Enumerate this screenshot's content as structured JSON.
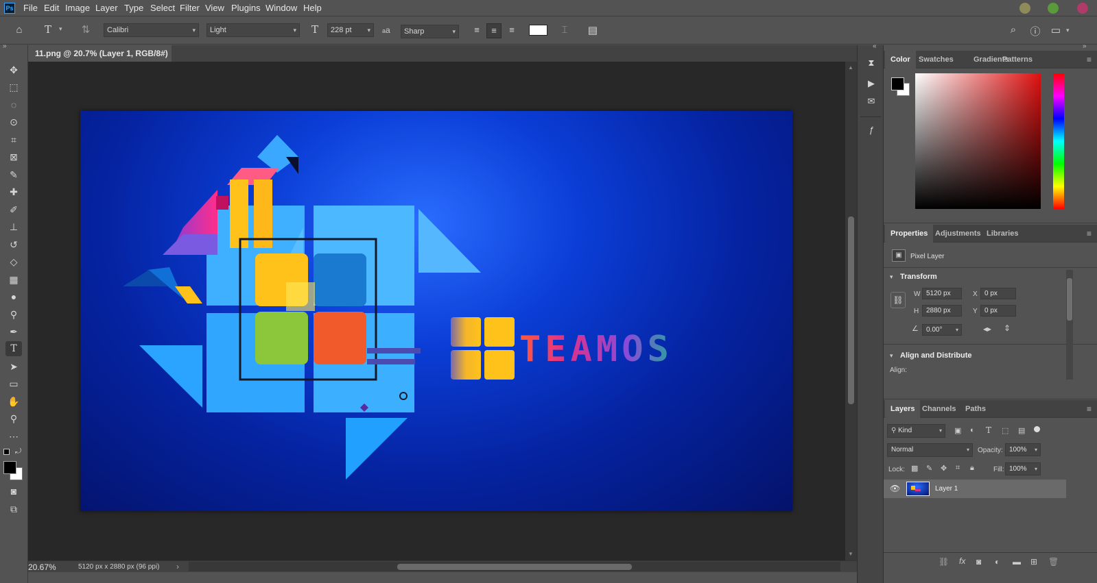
{
  "app": {
    "logo": "Ps"
  },
  "menu": [
    "File",
    "Edit",
    "Image",
    "Layer",
    "Type",
    "Select",
    "Filter",
    "View",
    "Plugins",
    "Window",
    "Help"
  ],
  "window_buttons": {
    "minimize_color": "#8e8a5a",
    "maximize_color": "#5a9a3a",
    "close_color": "#b03a6a"
  },
  "options": {
    "font_family": "Calibri",
    "font_style": "Light",
    "font_size": "228 pt",
    "aa_label": "a",
    "antialias": "Sharp",
    "text_color": "#ffffff"
  },
  "document": {
    "tab_title": "11.png @ 20.7% (Layer 1, RGB/8#)",
    "close_glyph": "×",
    "zoom": "20.67%",
    "doc_info": "5120 px x 2880 px (96 ppi)",
    "status_arrow": "›",
    "artwork_wordmark": "TEAMOS"
  },
  "color_panel": {
    "tabs": [
      "Color",
      "Swatches",
      "Gradients",
      "Patterns"
    ],
    "foreground": "#000000",
    "background": "#ffffff",
    "hue_color": "#e01010"
  },
  "properties_panel": {
    "tabs": [
      "Properties",
      "Adjustments",
      "Libraries"
    ],
    "kind": "Pixel Layer",
    "transform_title": "Transform",
    "w_label": "W",
    "w_value": "5120 px",
    "h_label": "H",
    "h_value": "2880 px",
    "x_label": "X",
    "x_value": "0 px",
    "y_label": "Y",
    "y_value": "0 px",
    "angle_value": "0.00°",
    "align_title": "Align and Distribute",
    "align_label": "Align:"
  },
  "layers_panel": {
    "tabs": [
      "Layers",
      "Channels",
      "Paths"
    ],
    "filter_kind": "Kind",
    "blend_mode": "Normal",
    "opacity_label": "Opacity:",
    "opacity_value": "100%",
    "lock_label": "Lock:",
    "fill_label": "Fill:",
    "fill_value": "100%",
    "layers": [
      {
        "name": "Layer 1",
        "visible": true
      }
    ]
  }
}
